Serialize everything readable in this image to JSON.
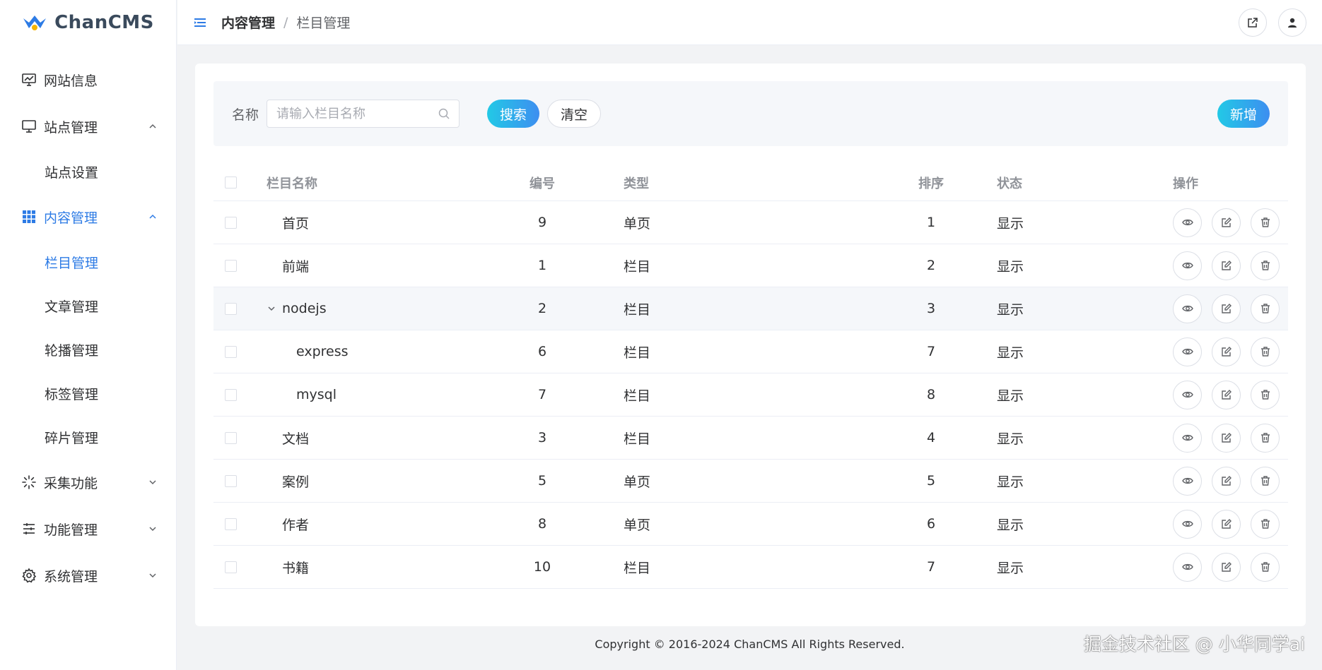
{
  "app": {
    "logo_text": "ChanCMS"
  },
  "sidebar": {
    "items": [
      {
        "label": "网站信息",
        "icon": "monitor-chart-icon"
      },
      {
        "label": "站点管理",
        "icon": "desktop-icon",
        "expanded": true
      },
      {
        "label": "站点设置",
        "sub": true
      },
      {
        "label": "内容管理",
        "icon": "grid-icon",
        "expanded": true,
        "active": true
      },
      {
        "label": "栏目管理",
        "sub": true,
        "active": true
      },
      {
        "label": "文章管理",
        "sub": true
      },
      {
        "label": "轮播管理",
        "sub": true
      },
      {
        "label": "标签管理",
        "sub": true
      },
      {
        "label": "碎片管理",
        "sub": true
      },
      {
        "label": "采集功能",
        "icon": "loading-icon"
      },
      {
        "label": "功能管理",
        "icon": "sliders-icon"
      },
      {
        "label": "系统管理",
        "icon": "gear-icon"
      }
    ]
  },
  "header": {
    "breadcrumb": {
      "first": "内容管理",
      "separator": "/",
      "last": "栏目管理"
    }
  },
  "search": {
    "label": "名称",
    "placeholder": "请输入栏目名称",
    "value": "",
    "search_button": "搜索",
    "clear_button": "清空",
    "add_button": "新增"
  },
  "table": {
    "columns": {
      "name": "栏目名称",
      "code": "编号",
      "type": "类型",
      "sort": "排序",
      "status": "状态",
      "ops": "操作"
    },
    "rows": [
      {
        "name": "首页",
        "code": "9",
        "type": "单页",
        "sort": "1",
        "status": "显示",
        "level": 0
      },
      {
        "name": "前端",
        "code": "1",
        "type": "栏目",
        "sort": "2",
        "status": "显示",
        "level": 0
      },
      {
        "name": "nodejs",
        "code": "2",
        "type": "栏目",
        "sort": "3",
        "status": "显示",
        "level": 0,
        "expandable": true
      },
      {
        "name": "express",
        "code": "6",
        "type": "栏目",
        "sort": "7",
        "status": "显示",
        "level": 1
      },
      {
        "name": "mysql",
        "code": "7",
        "type": "栏目",
        "sort": "8",
        "status": "显示",
        "level": 1
      },
      {
        "name": "文档",
        "code": "3",
        "type": "栏目",
        "sort": "4",
        "status": "显示",
        "level": 0
      },
      {
        "name": "案例",
        "code": "5",
        "type": "单页",
        "sort": "5",
        "status": "显示",
        "level": 0
      },
      {
        "name": "作者",
        "code": "8",
        "type": "单页",
        "sort": "6",
        "status": "显示",
        "level": 0
      },
      {
        "name": "书籍",
        "code": "10",
        "type": "栏目",
        "sort": "7",
        "status": "显示",
        "level": 0
      }
    ]
  },
  "footer": {
    "copyright": "Copyright © 2016-2024 ChanCMS All Rights Reserved."
  },
  "watermark": "掘金技术社区 @ 小华同学ai",
  "colors": {
    "accent": "#2d7be5",
    "gradient_start": "#22c9e6",
    "gradient_end": "#3d8ef0"
  }
}
